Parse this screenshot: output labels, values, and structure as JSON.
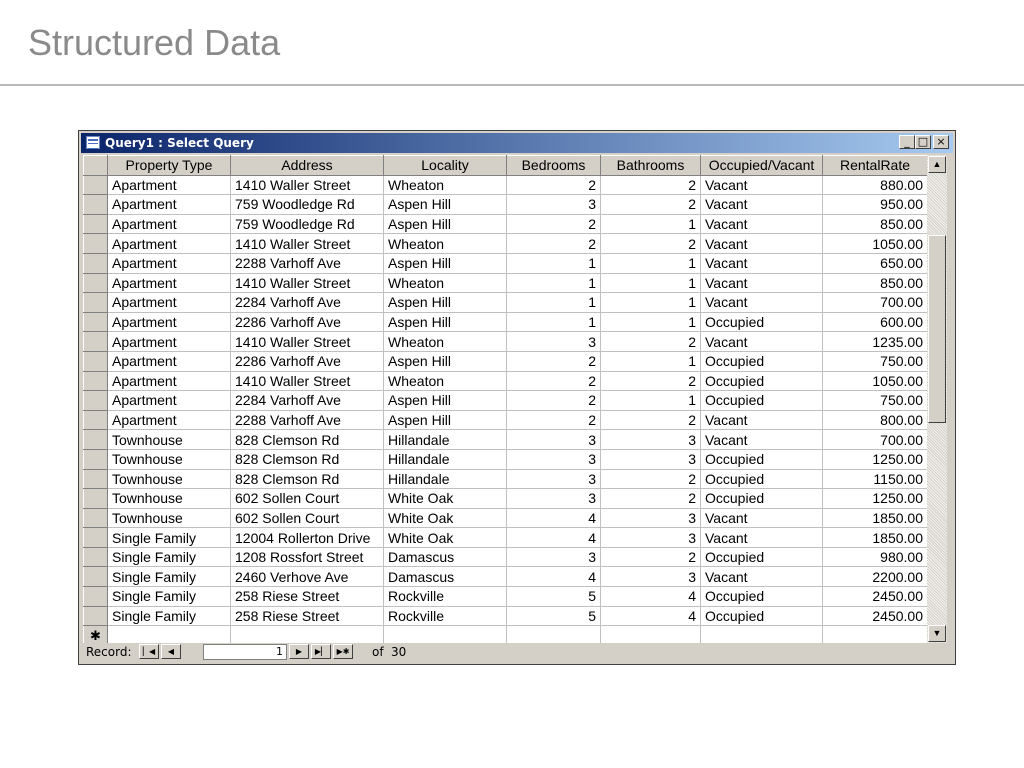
{
  "slide": {
    "title": "Structured Data"
  },
  "window": {
    "title": "Query1 : Select Query",
    "min_label": "_",
    "max_label": "□",
    "close_label": "×"
  },
  "table": {
    "columns": [
      "Property Type",
      "Address",
      "Locality",
      "Bedrooms",
      "Bathrooms",
      "Occupied/Vacant",
      "RentalRate"
    ],
    "rows": [
      [
        "Apartment",
        "1410 Waller Street",
        "Wheaton",
        "2",
        "2",
        "Vacant",
        "880.00"
      ],
      [
        "Apartment",
        "759 Woodledge Rd",
        "Aspen Hill",
        "3",
        "2",
        "Vacant",
        "950.00"
      ],
      [
        "Apartment",
        "759 Woodledge Rd",
        "Aspen Hill",
        "2",
        "1",
        "Vacant",
        "850.00"
      ],
      [
        "Apartment",
        "1410 Waller Street",
        "Wheaton",
        "2",
        "2",
        "Vacant",
        "1050.00"
      ],
      [
        "Apartment",
        "2288 Varhoff Ave",
        "Aspen Hill",
        "1",
        "1",
        "Vacant",
        "650.00"
      ],
      [
        "Apartment",
        "1410 Waller Street",
        "Wheaton",
        "1",
        "1",
        "Vacant",
        "850.00"
      ],
      [
        "Apartment",
        "2284 Varhoff Ave",
        "Aspen Hill",
        "1",
        "1",
        "Vacant",
        "700.00"
      ],
      [
        "Apartment",
        "2286 Varhoff Ave",
        "Aspen Hill",
        "1",
        "1",
        "Occupied",
        "600.00"
      ],
      [
        "Apartment",
        "1410 Waller Street",
        "Wheaton",
        "3",
        "2",
        "Vacant",
        "1235.00"
      ],
      [
        "Apartment",
        "2286 Varhoff Ave",
        "Aspen Hill",
        "2",
        "1",
        "Occupied",
        "750.00"
      ],
      [
        "Apartment",
        "1410 Waller Street",
        "Wheaton",
        "2",
        "2",
        "Occupied",
        "1050.00"
      ],
      [
        "Apartment",
        "2284 Varhoff Ave",
        "Aspen Hill",
        "2",
        "1",
        "Occupied",
        "750.00"
      ],
      [
        "Apartment",
        "2288 Varhoff Ave",
        "Aspen Hill",
        "2",
        "2",
        "Vacant",
        "800.00"
      ],
      [
        "Townhouse",
        "828 Clemson Rd",
        "Hillandale",
        "3",
        "3",
        "Vacant",
        "700.00"
      ],
      [
        "Townhouse",
        "828 Clemson Rd",
        "Hillandale",
        "3",
        "3",
        "Occupied",
        "1250.00"
      ],
      [
        "Townhouse",
        "828 Clemson Rd",
        "Hillandale",
        "3",
        "2",
        "Occupied",
        "1150.00"
      ],
      [
        "Townhouse",
        "602 Sollen Court",
        "White Oak",
        "3",
        "2",
        "Occupied",
        "1250.00"
      ],
      [
        "Townhouse",
        "602 Sollen Court",
        "White Oak",
        "4",
        "3",
        "Vacant",
        "1850.00"
      ],
      [
        "Single Family",
        "12004 Rollerton Drive",
        "White Oak",
        "4",
        "3",
        "Vacant",
        "1850.00"
      ],
      [
        "Single Family",
        "1208 Rossfort Street",
        "Damascus",
        "3",
        "2",
        "Occupied",
        "980.00"
      ],
      [
        "Single Family",
        "2460 Verhove Ave",
        "Damascus",
        "4",
        "3",
        "Vacant",
        "2200.00"
      ],
      [
        "Single Family",
        "258 Riese Street",
        "Rockville",
        "5",
        "4",
        "Occupied",
        "2450.00"
      ],
      [
        "Single Family",
        "258 Riese Street",
        "Rockville",
        "5",
        "4",
        "Occupied",
        "2450.00"
      ]
    ],
    "new_record_marker": "✱"
  },
  "navigation": {
    "record_label": "Record:",
    "current_record": "1",
    "of_label": "of",
    "total_records": "30",
    "first_icon": "first-record-icon",
    "prev_icon": "previous-record-icon",
    "next_icon": "next-record-icon",
    "last_icon": "last-record-icon",
    "new_icon": "new-record-icon"
  }
}
